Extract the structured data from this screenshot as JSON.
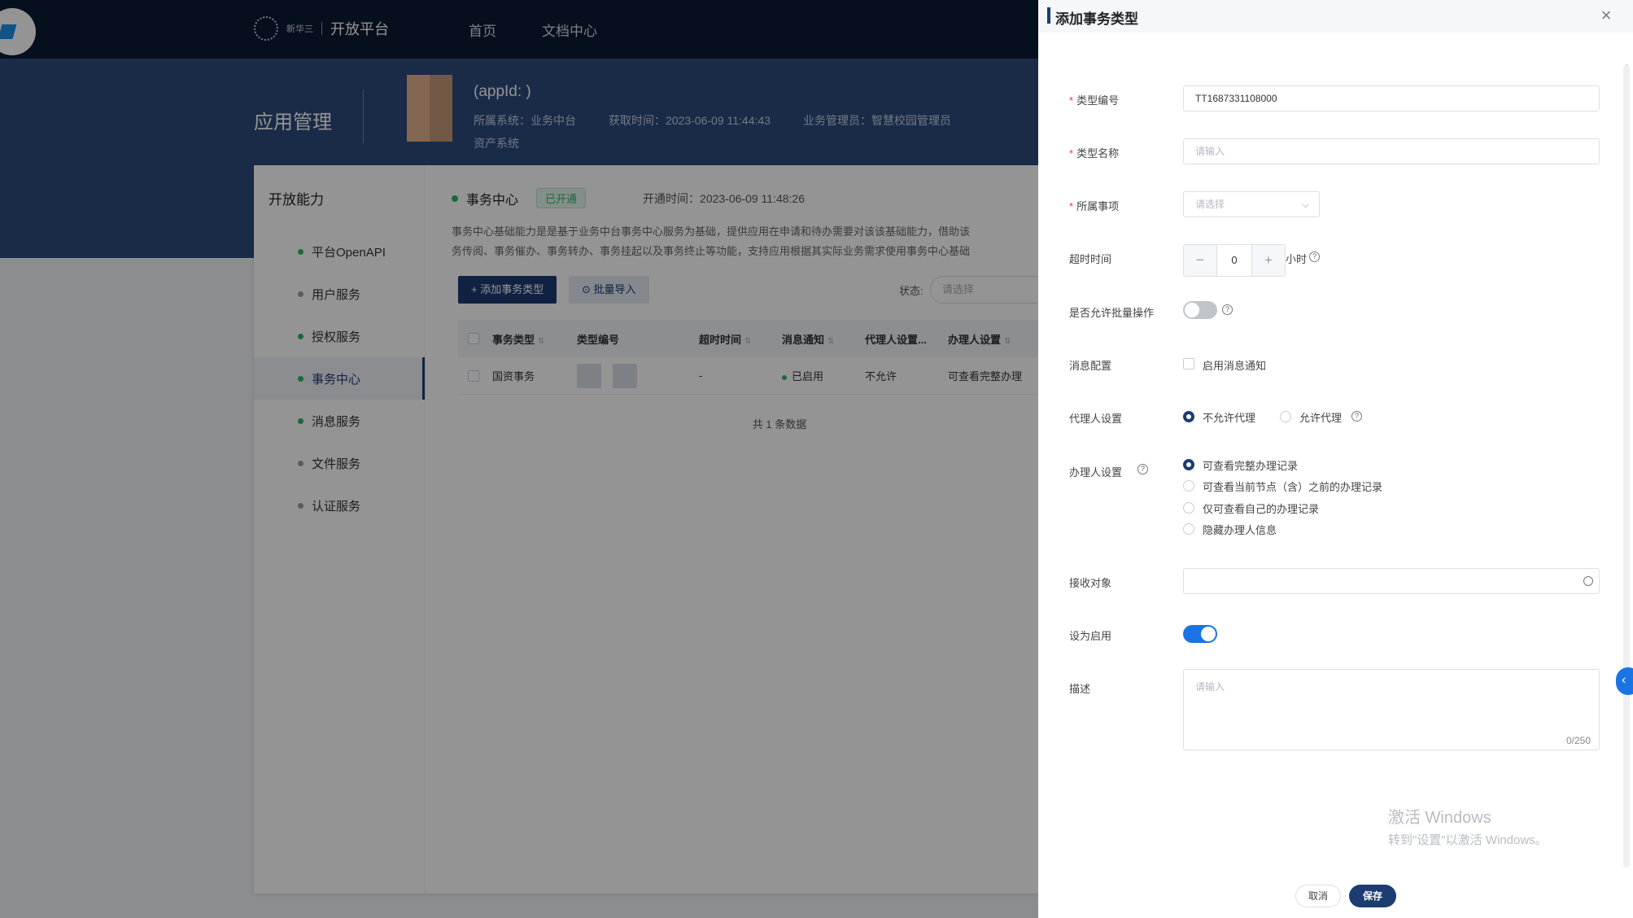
{
  "topbar": {
    "brand_small": "新华三",
    "brand_name": "开放平台",
    "nav": [
      "首页",
      "文档中心"
    ]
  },
  "hero": {
    "title": "应用管理",
    "app_name": "(appId:                    )",
    "owner_system": "所属系统：业务中台",
    "acquire_time": "获取时间：2023-06-09 11:44:43",
    "business_admin": "业务管理员：智慧校园管理员",
    "asset_system": "资产系统"
  },
  "sidebar": {
    "title": "开放能力",
    "items": [
      {
        "label": "平台OpenAPI"
      },
      {
        "label": "用户服务"
      },
      {
        "label": "授权服务"
      },
      {
        "label": "事务中心"
      },
      {
        "label": "消息服务"
      },
      {
        "label": "文件服务"
      },
      {
        "label": "认证服务"
      }
    ]
  },
  "service": {
    "name": "事务中心",
    "status_tag": "已开通",
    "open_time": "开通时间：2023-06-09 11:48:26",
    "desc_line1": "事务中心基础能力是是基于业务中台事务中心服务为基础，提供应用在申请和待办需要对该该基础能力，借助该",
    "desc_line2": "务传阅、事务催办、事务转办、事务挂起以及事务终止等功能，支持应用根据其实际业务需求使用事务中心基础",
    "add_button": "+ 添加事务类型",
    "import_button": "⊙ 批量导入",
    "status_label": "状态:",
    "status_placeholder": "请选择"
  },
  "table": {
    "headers": [
      "事务类型",
      "类型编号",
      "超时时间",
      "消息通知",
      "代理人设置...",
      "办理人设置"
    ],
    "rows": [
      {
        "type": "国资事务",
        "timeout": "-",
        "notify": "已启用",
        "proxy": "不允许",
        "handler": "可查看完整办理"
      }
    ],
    "total": "共 1 条数据"
  },
  "drawer": {
    "title": "添加事务类型",
    "fields": {
      "type_code_label": "类型编号",
      "type_code_value": "TT1687331108000",
      "type_name_label": "类型名称",
      "type_name_placeholder": "请输入",
      "matter_label": "所属事项",
      "matter_placeholder": "请选择",
      "timeout_label": "超时时间",
      "timeout_value": "0",
      "timeout_unit": "小时",
      "batch_label": "是否允许批量操作",
      "message_label": "消息配置",
      "message_option": "启用消息通知",
      "proxy_label": "代理人设置",
      "proxy_options": [
        "不允许代理",
        "允许代理"
      ],
      "handler_label": "办理人设置",
      "handler_options": [
        "可查看完整办理记录",
        "可查看当前节点（含）之前的办理记录",
        "仅可查看自己的办理记录",
        "隐藏办理人信息"
      ],
      "receiver_label": "接收对象",
      "enable_label": "设为启用",
      "desc_label": "描述",
      "desc_placeholder": "请输入",
      "desc_counter": "0/250"
    },
    "cancel": "取消",
    "save": "保存"
  },
  "watermark": {
    "line1": "激活 Windows",
    "line2": "转到\"设置\"以激活 Windows。"
  },
  "colors": {
    "primary": "#1d3c72",
    "switch_on": "#1a74e3",
    "success": "#2fb46b",
    "required": "#e23b3b"
  }
}
